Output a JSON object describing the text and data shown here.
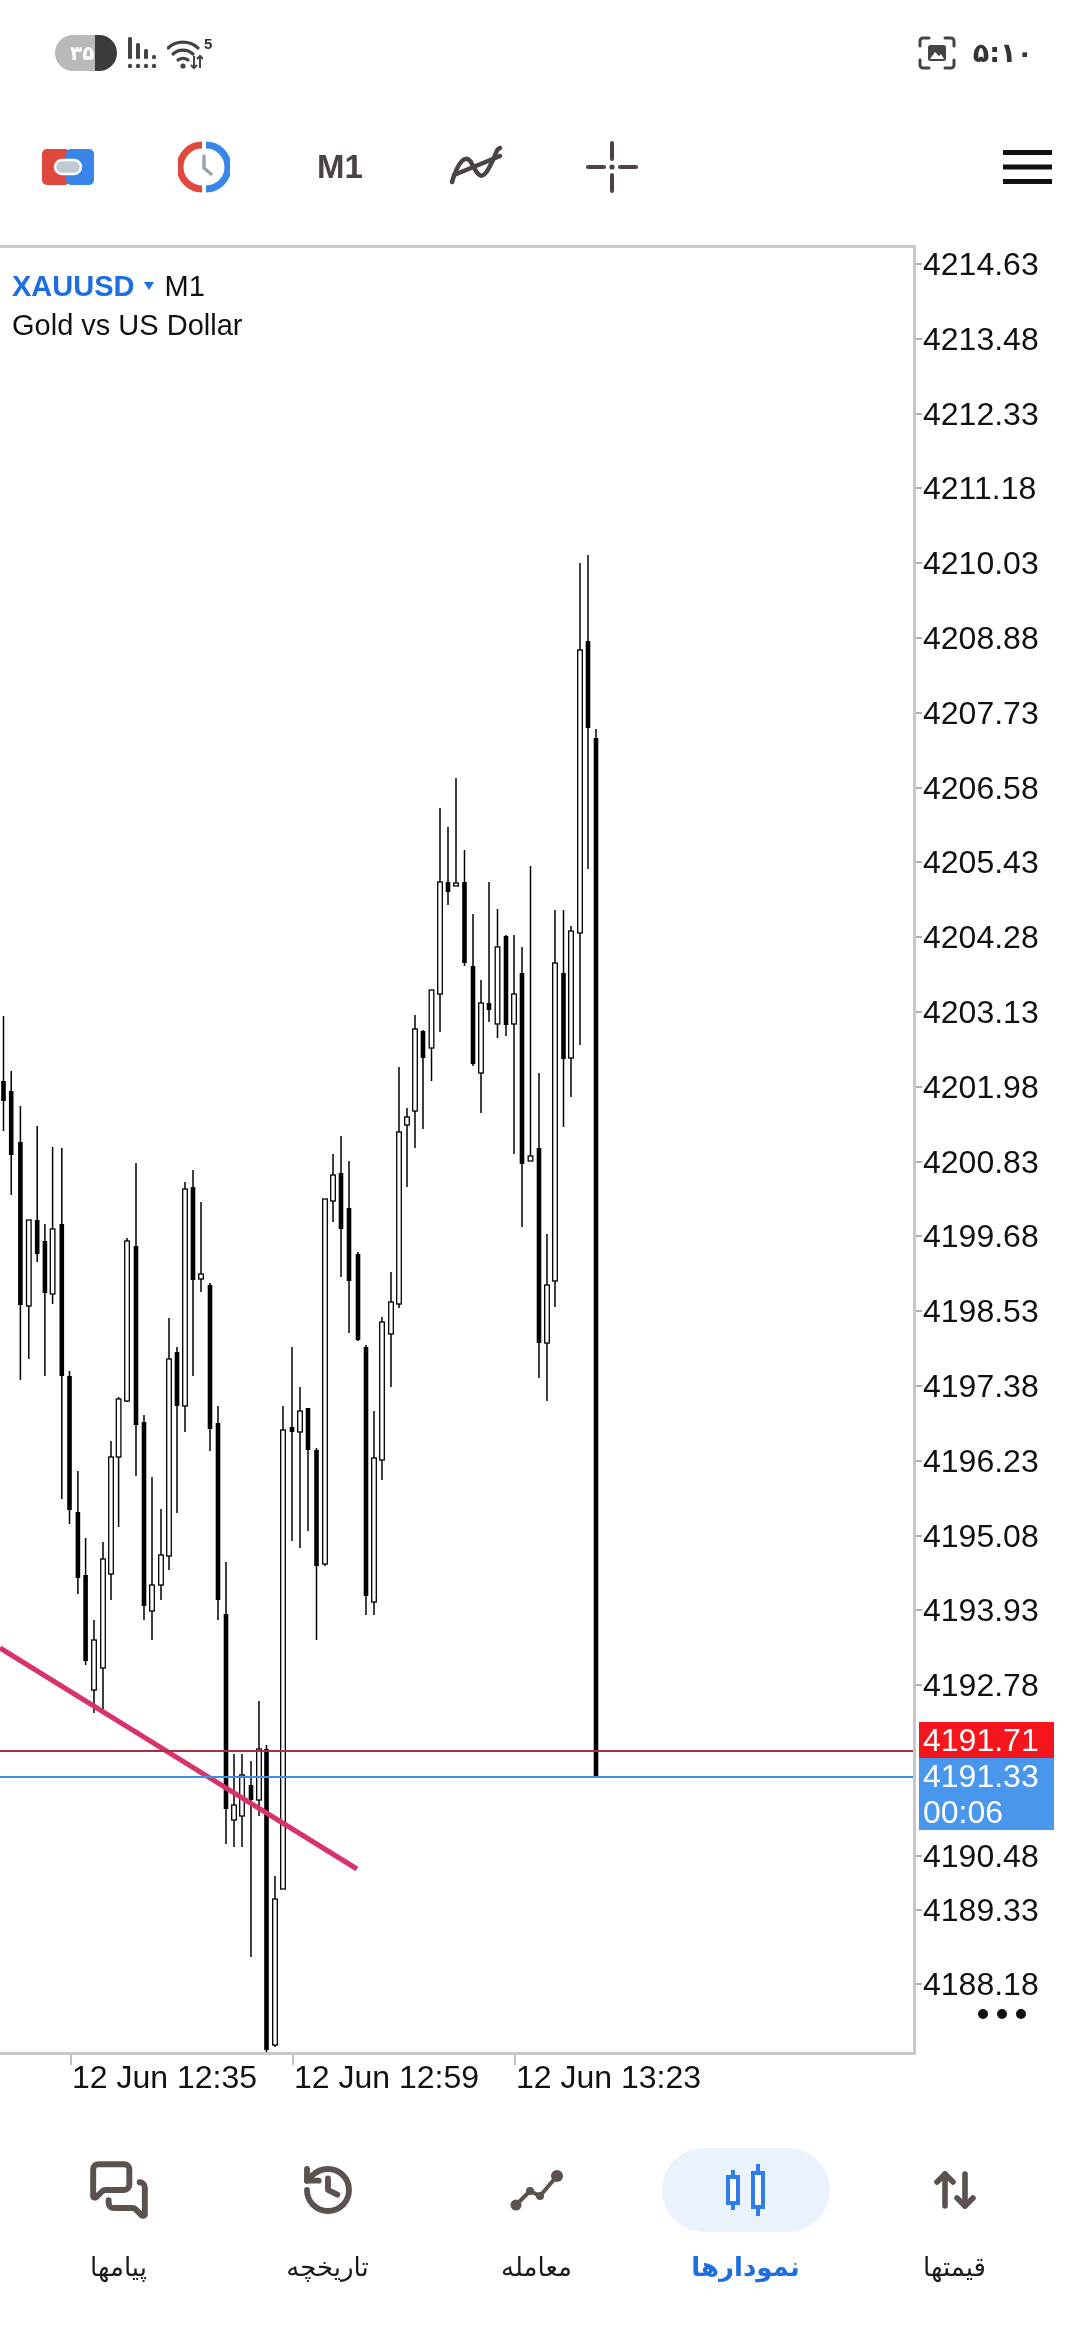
{
  "status_bar": {
    "battery": "۳۵",
    "network_badge": "5",
    "time": "۵:۱۰"
  },
  "toolbar": {
    "timeframe": "M1"
  },
  "chart": {
    "symbol": "XAUUSD",
    "timeframe": "M1",
    "description": "Gold vs US Dollar",
    "price_scale_upper": [
      "4214.63",
      "4213.48",
      "4212.33",
      "4211.18",
      "4210.03",
      "4208.88",
      "4207.73",
      "4206.58",
      "4205.43",
      "4204.28",
      "4203.13",
      "4201.98",
      "4200.83",
      "4199.68",
      "4198.53",
      "4197.38",
      "4196.23",
      "4195.08",
      "4193.93",
      "4192.78"
    ],
    "price_scale_lower": [
      "4190.48",
      "4189.33",
      "4188.18"
    ],
    "ask_price": "4191.71",
    "bid_price": "4191.33",
    "bar_timer": "00:06",
    "time_scale": [
      "12 Jun 12:35",
      "12 Jun 12:59",
      "12 Jun 13:23"
    ]
  },
  "bottom_nav": [
    {
      "label": "قیمتها",
      "selected": false
    },
    {
      "label": "نمودارها",
      "selected": true
    },
    {
      "label": "معامله",
      "selected": false
    },
    {
      "label": "تاریخچه",
      "selected": false
    },
    {
      "label": "پیامها",
      "selected": false
    }
  ]
}
